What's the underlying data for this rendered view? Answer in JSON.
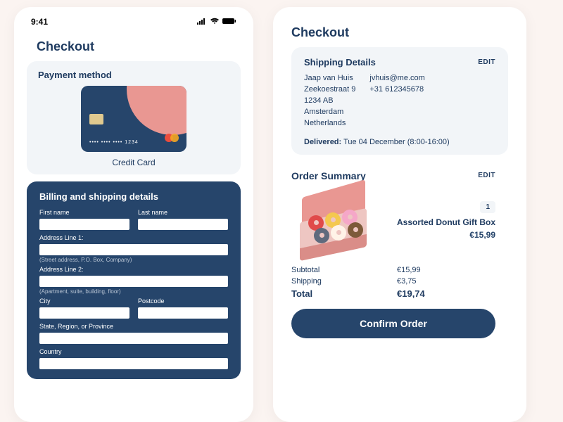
{
  "status": {
    "time": "9:41",
    "signal": "●●●●",
    "wifi": "wifi",
    "battery": "battery"
  },
  "left": {
    "title": "Checkout",
    "payment": {
      "heading": "Payment method",
      "cc_masked": "•••• •••• •••• 1234",
      "label": "Credit Card"
    },
    "billing": {
      "heading": "Billing and shipping details",
      "first_name": "First name",
      "last_name": "Last name",
      "addr1": "Address Line 1:",
      "addr1_hint": "(Street address, P.O. Box, Company)",
      "addr2": "Address Line 2:",
      "addr2_hint": "(Apartment, suite, building, floor)",
      "city": "City",
      "postcode": "Postcode",
      "state": "State, Region, or Province",
      "country": "Country"
    }
  },
  "right": {
    "title": "Checkout",
    "shipping": {
      "heading": "Shipping Details",
      "edit": "EDIT",
      "name": "Jaap van Huis",
      "street": "Zeekoestraat 9",
      "zip": "1234 AB",
      "city": "Amsterdam",
      "country": "Netherlands",
      "email": "jvhuis@me.com",
      "phone": "+31 612345678",
      "delivered_label": "Delivered:",
      "delivered_value": "Tue 04 December (8:00-16:00)"
    },
    "order": {
      "heading": "Order Summary",
      "edit": "EDIT",
      "item_qty": "1",
      "item_name": "Assorted Donut Gift Box",
      "item_price": "€15,99",
      "subtotal_label": "Subtotal",
      "subtotal": "€15,99",
      "shipping_label": "Shipping",
      "shipping": "€3,75",
      "total_label": "Total",
      "total": "€19,74",
      "confirm": "Confirm Order"
    }
  }
}
